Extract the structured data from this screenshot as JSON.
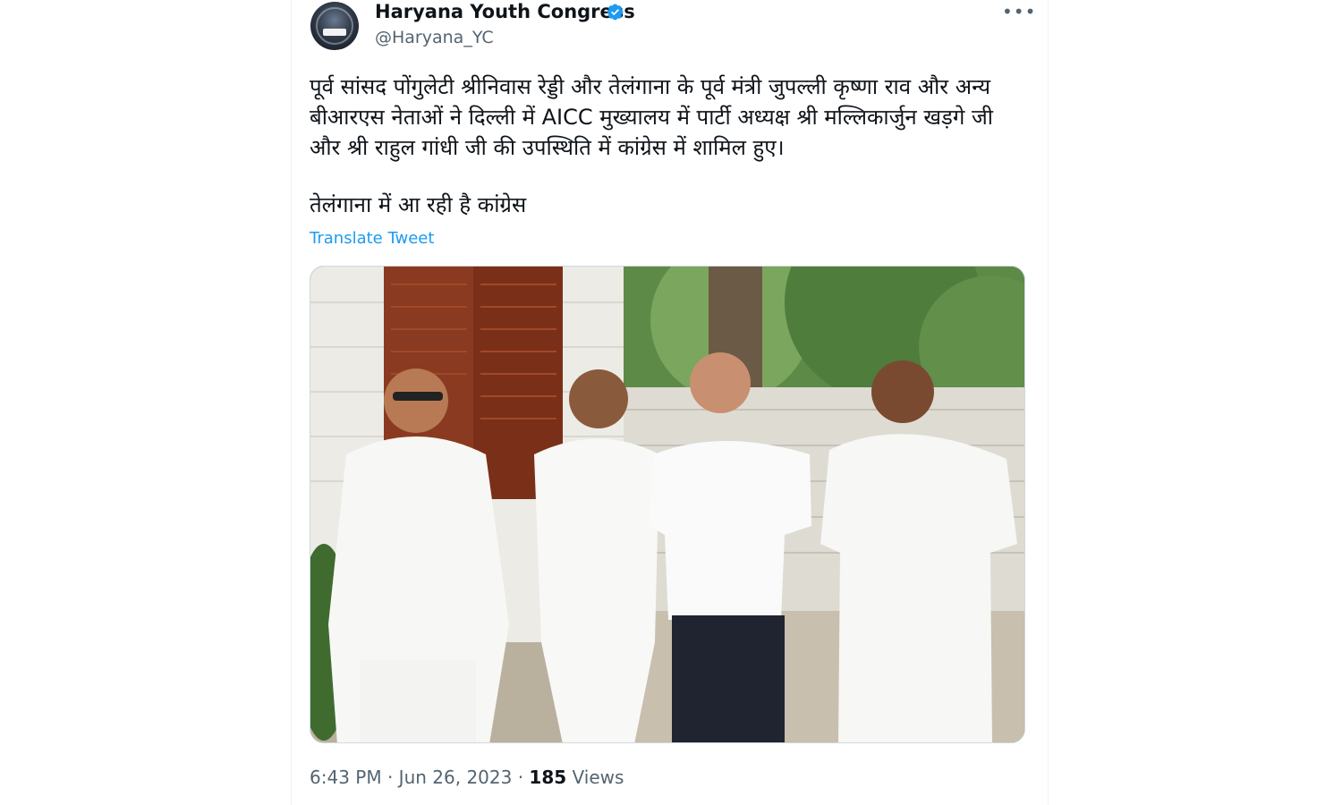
{
  "author": {
    "display_name": "Haryana Youth Congress",
    "handle": "@Haryana_YC",
    "verified": true,
    "verified_color": "#1d9bf0"
  },
  "more_label": "•••",
  "tweet": {
    "text_paragraph_1": "पूर्व सांसद पोंगुलेटी श्रीनिवास रेड्डी और तेलंगाना के पूर्व मंत्री जुपल्ली कृष्णा राव और अन्य बीआरएस नेताओं ने दिल्ली में AICC मुख्यालय में पार्टी अध्यक्ष श्री मल्लिकार्जुन खड़गे जी और श्री राहुल गांधी जी की उपस्थिति में कांग्रेस में शामिल हुए।",
    "text_paragraph_2": "तेलंगाना में आ रही है कांग्रेस",
    "translate_label": "Translate Tweet",
    "time": "6:43 PM",
    "separator_1": " · ",
    "date": "Jun 26, 2023",
    "separator_2": " · ",
    "views_count": "185",
    "views_label": " Views"
  },
  "colors": {
    "text_primary": "#0f1419",
    "text_secondary": "#536471",
    "link": "#1d9bf0"
  },
  "photo": {
    "subject": "four-men-in-white-standing-outdoors-photo"
  }
}
